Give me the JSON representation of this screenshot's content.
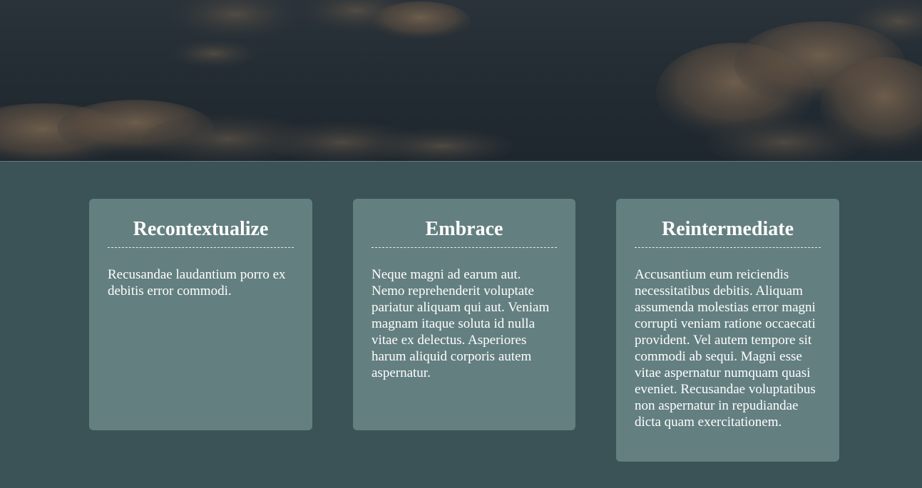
{
  "hero": {
    "image": "cloudy-night-sky",
    "colors": {
      "sky": "#222b32",
      "clouds": "#6b5a4a"
    }
  },
  "page": {
    "background": "#3b5257",
    "card_background": "#647f80"
  },
  "cards": [
    {
      "title": "Recontextualize",
      "body": "Recusandae laudantium porro ex debitis error commodi."
    },
    {
      "title": "Embrace",
      "body": "Neque magni ad earum aut. Nemo reprehenderit voluptate pariatur aliquam qui aut. Veniam magnam itaque soluta id nulla vitae ex delectus. Asperiores harum aliquid corporis autem aspernatur."
    },
    {
      "title": "Reintermediate",
      "body": "Accusantium eum reiciendis necessitatibus debitis. Aliquam assumenda molestias error magni corrupti veniam ratione occaecati provident. Vel autem tempore sit commodi ab sequi. Magni esse vitae aspernatur numquam quasi eveniet. Recusandae voluptatibus non aspernatur in repudiandae dicta quam exercitationem."
    }
  ]
}
